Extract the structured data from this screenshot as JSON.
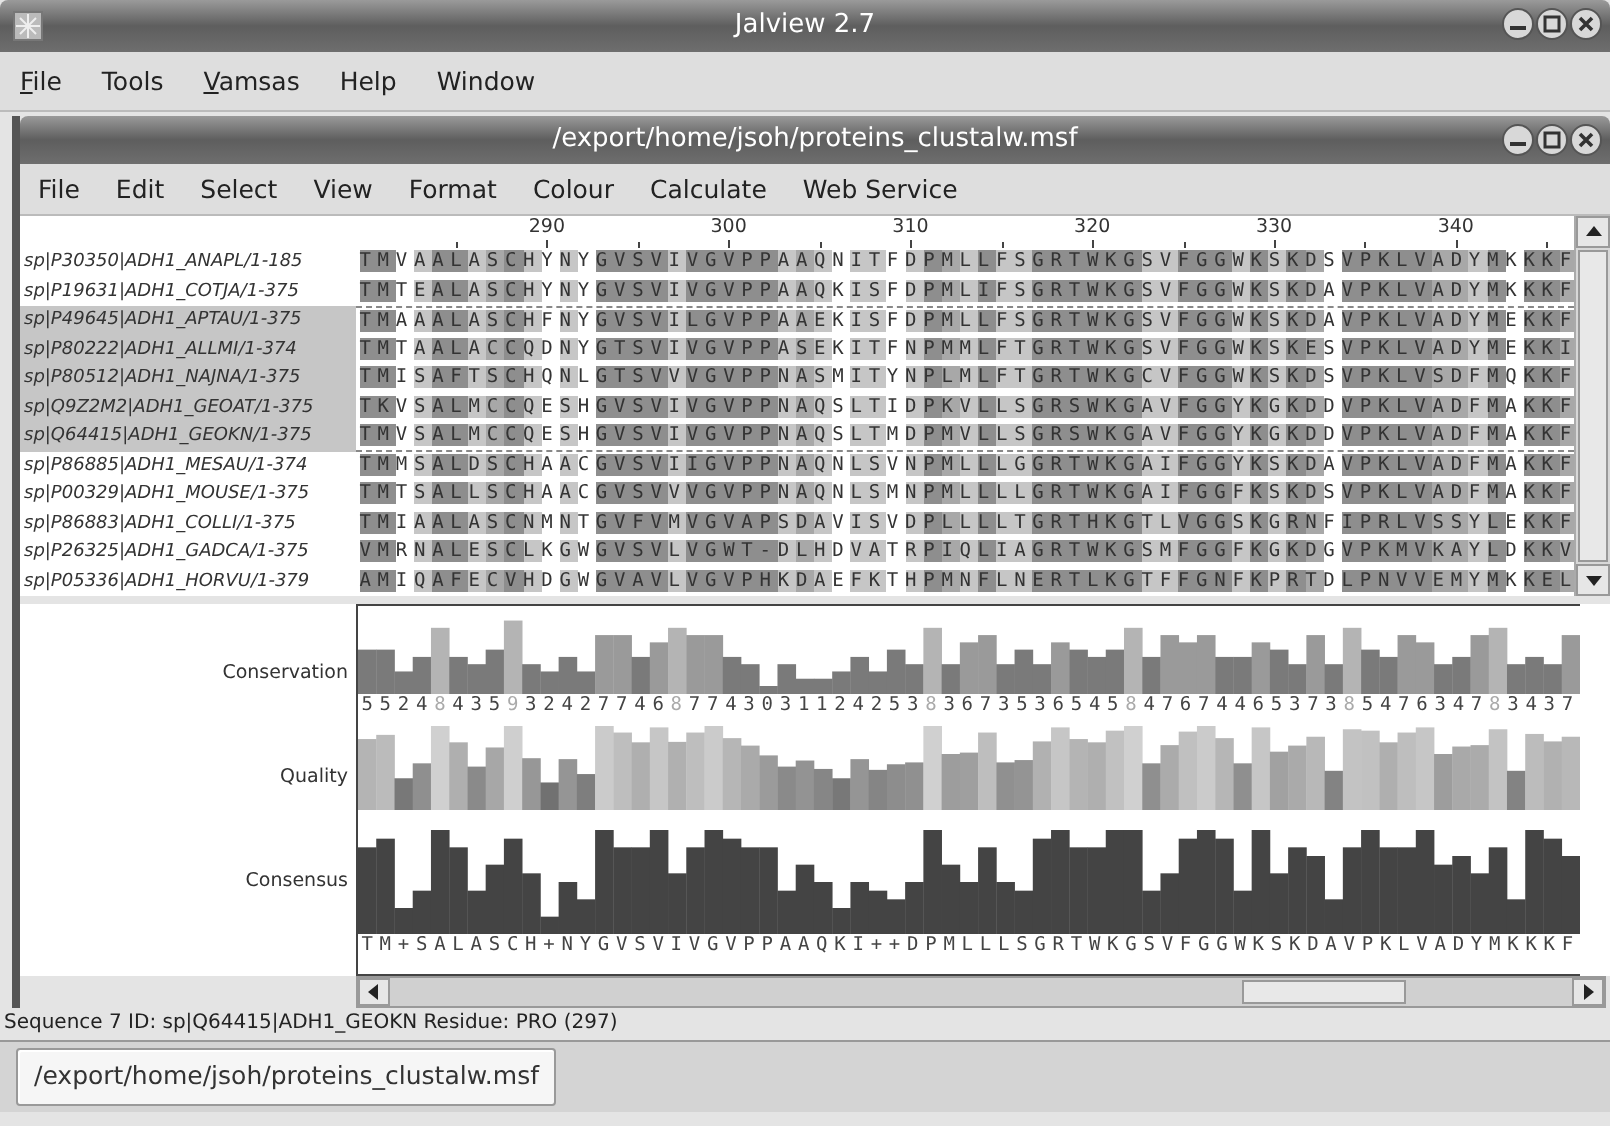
{
  "app_window": {
    "title": "Jalview 2.7",
    "menus": [
      {
        "label": "File",
        "mnemonic": true
      },
      {
        "label": "Tools",
        "mnemonic": false
      },
      {
        "label": "Vamsas",
        "mnemonic": true
      },
      {
        "label": "Help",
        "mnemonic": false
      },
      {
        "label": "Window",
        "mnemonic": false
      }
    ]
  },
  "alignment_window": {
    "title": "/export/home/jsoh/proteins_clustalw.msf",
    "menus": [
      "File",
      "Edit",
      "Select",
      "View",
      "Format",
      "Colour",
      "Calculate",
      "Web Service"
    ]
  },
  "ruler": [
    "290",
    "300",
    "310",
    "320",
    "330",
    "340"
  ],
  "sequences": [
    {
      "id": "sp|P30350|ADH1_ANAPL/1-185",
      "residues": "TMVAALASCHYNYGVSVIVGVPPAAQNITFDPMLLFSGRTWKGSVFGGWKSKDSVPKLVADYMKKKF",
      "selected": false
    },
    {
      "id": "sp|P19631|ADH1_COTJA/1-375",
      "residues": "TMTEALASCHYNYGVSVIVGVPPAAQKISFDPMLIFSGRTWKGSVFGGWKSKDAVPKLVADYMKKKF",
      "selected": false
    },
    {
      "id": "sp|P49645|ADH1_APTAU/1-375",
      "residues": "TMAAALASCHFNYGVSVILGVPPAAEKISFDPMLLFSGRTWKGSVFGGWKSKDAVPKLVADYMEKKF",
      "selected": true
    },
    {
      "id": "sp|P80222|ADH1_ALLMI/1-374",
      "residues": "TMTAALACCQDNYGTSVIVGVPPASEKITFNPMMLFTGRTWKGSVFGGWKSKESVPKLVADYMEKKI",
      "selected": true
    },
    {
      "id": "sp|P80512|ADH1_NAJNA/1-375",
      "residues": "TMISAFTSCHQNLGTSVVVGVPPNASMITYNPLMLFTGRTWKGCVFGGWKSKDSVPKLVSDFMQKKF",
      "selected": true
    },
    {
      "id": "sp|Q9Z2M2|ADH1_GEOAT/1-375",
      "residues": "TKVSALMCCQESHGVSVIVGVPPNAQSLTIDPKVLLSGRSWKGAVFGGYKGKDDVPKLVADFMAKKF",
      "selected": true
    },
    {
      "id": "sp|Q64415|ADH1_GEOKN/1-375",
      "residues": "TMVSALMCCQESHGVSVIVGVPPNAQSLTMDPMVLLSGRSWKGAVFGGYKGKDDVPKLVADFMAKKF",
      "selected": true
    },
    {
      "id": "sp|P86885|ADH1_MESAU/1-374",
      "residues": "TMMSALDSCHAACGVSVIIGVPPNAQNLSVNPMLLLGGRTWKGAIFGGYKSKDAVPKLVADFMAKKF",
      "selected": false
    },
    {
      "id": "sp|P00329|ADH1_MOUSE/1-375",
      "residues": "TMTSALLSCHAACGVSVVVGVPPNAQNLSMNPMLLLLGRTWKGAIFGGFKSKDSVPKLVADFMAKKF",
      "selected": false
    },
    {
      "id": "sp|P86883|ADH1_COLLI/1-375",
      "residues": "TMIAALASCNMNTGVFVMVGVAPSDAVISVDPLLLLTGRTHKGTLVGGSKGRNFIPRLVSSYLEKKF",
      "selected": false
    },
    {
      "id": "sp|P26325|ADH1_GADCA/1-375",
      "residues": "VMRNALESCLKGWGVSVLVGWT-DLHDVATRPIQLIAGRTWKGSMFGGFKGKDGVPKMVKAYLDKKV",
      "selected": false
    },
    {
      "id": "sp|P05336|ADH1_HORVU/1-379",
      "residues": "AMIQAFECVHDGWGVAVLVGVPHKDAEFKTHPMNFLNERTLKGTFFGNFKPRTDLPNVVEMYMKKEL",
      "selected": false
    }
  ],
  "annotations": {
    "labels": [
      "Conservation",
      "Quality",
      "Consensus"
    ],
    "conservation": "5524843593242774687743031124253836735365458476744653738547634783437",
    "consensus": "TM+SALASCH+NYGVSVIVGVPPAAQKI++DPMLLLSGRTWKGSVFGGWKSKDAVPKLVADYMKKKF"
  },
  "status_bar": "Sequence 7 ID: sp|Q64415|ADH1_GEOKN  Residue: PRO (297)",
  "taskbar": [
    {
      "label": "/export/home/jsoh/proteins_clustalw.msf",
      "selected": true
    }
  ]
}
